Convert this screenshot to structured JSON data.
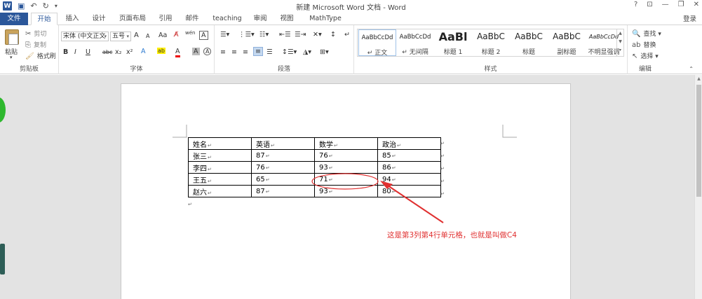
{
  "window": {
    "title": "新建 Microsoft Word 文档 - Word",
    "controls": [
      "?",
      "⊡",
      "—",
      "❐",
      "✕"
    ]
  },
  "qat": {
    "logo": "W",
    "save": "💾",
    "undo": "↶",
    "redo": "↻",
    "customize": "₹"
  },
  "tabs": [
    "文件",
    "开始",
    "插入",
    "设计",
    "页面布局",
    "引用",
    "邮件",
    "teaching",
    "审阅",
    "视图",
    "MathType"
  ],
  "login": "登录",
  "ribbon": {
    "clipboard": {
      "paste": "粘贴",
      "cut": "剪切",
      "copy": "复制",
      "format_painter": "格式刷",
      "label": "剪贴板"
    },
    "font": {
      "font_name": "宋体 (中文正文",
      "font_size": "五号",
      "grow": "A",
      "shrink": "A",
      "case": "Aa",
      "clear": "⌫",
      "wen": "wén",
      "char_border": "A",
      "bold": "B",
      "italic": "I",
      "underline": "U",
      "strike": "abc",
      "sub": "x₂",
      "sup": "x²",
      "effect": "A",
      "highlight": "ab",
      "color": "A",
      "shade": "A",
      "enclose": "A",
      "label": "字体"
    },
    "paragraph": {
      "label": "段落"
    },
    "styles": {
      "items": [
        {
          "sample": "AaBbCcDd",
          "name": "↵ 正文"
        },
        {
          "sample": "AaBbCcDd",
          "name": "↵ 无间隔"
        },
        {
          "sample": "AaBl",
          "name": "标题 1"
        },
        {
          "sample": "AaBbC",
          "name": "标题 2"
        },
        {
          "sample": "AaBbC",
          "name": "标题"
        },
        {
          "sample": "AaBbC",
          "name": "副标题"
        },
        {
          "sample": "AaBbCcDd",
          "name": "不明显强调"
        }
      ],
      "label": "样式"
    },
    "editing": {
      "find": "查找",
      "replace": "替换",
      "select": "选择",
      "label": "编辑"
    }
  },
  "table": {
    "rows": [
      [
        "姓名",
        "英语",
        "数学",
        "政治"
      ],
      [
        "张三",
        "87",
        "76",
        "85"
      ],
      [
        "李四",
        "76",
        "93",
        "86"
      ],
      [
        "王五",
        "65",
        "71",
        "94"
      ],
      [
        "赵六",
        "87",
        "93",
        "80"
      ]
    ]
  },
  "annotation": {
    "text": "这是第3列第4行单元格，也就是叫做C4",
    "color": "#e03030"
  },
  "colors": {
    "accent": "#2b579a",
    "annotation": "#e03030"
  }
}
